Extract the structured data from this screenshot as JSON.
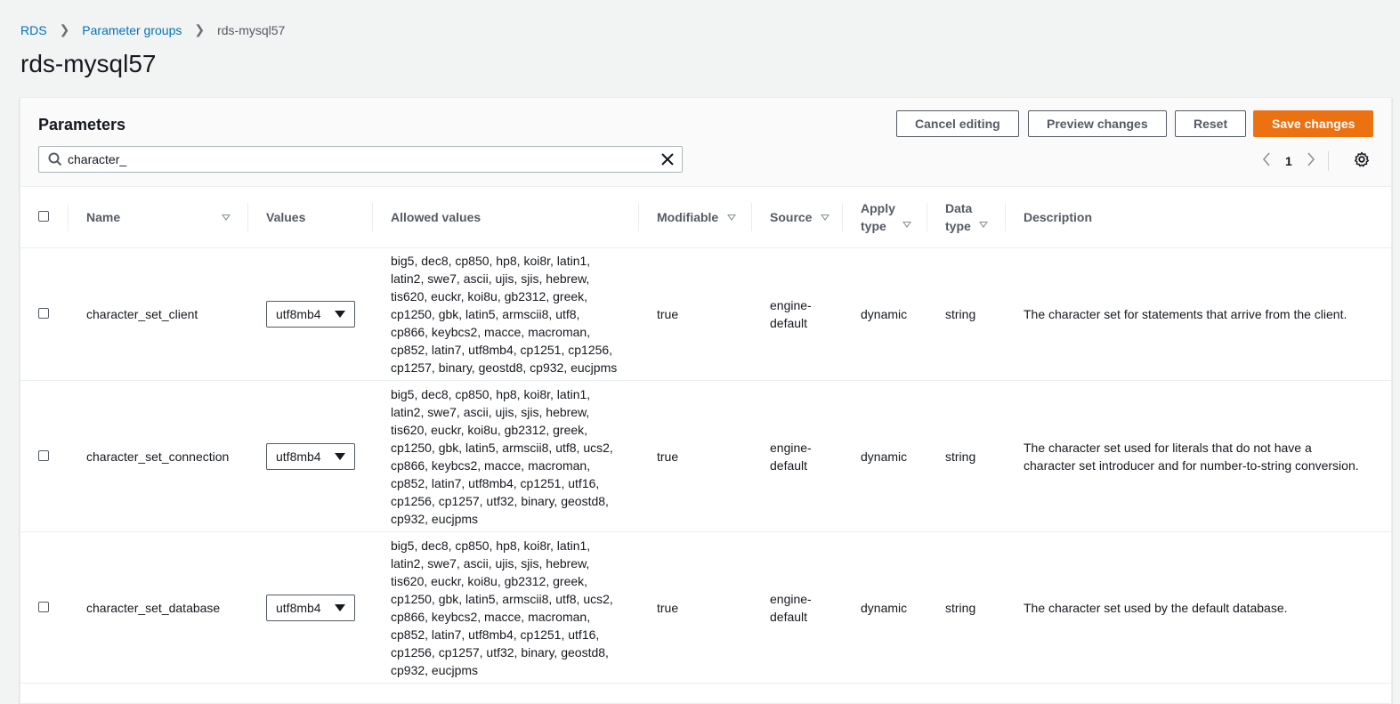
{
  "breadcrumb": {
    "root": "RDS",
    "parent": "Parameter groups",
    "current": "rds-mysql57"
  },
  "page_title": "rds-mysql57",
  "panel": {
    "title": "Parameters",
    "buttons": {
      "cancel": "Cancel editing",
      "preview": "Preview changes",
      "reset": "Reset",
      "save": "Save changes"
    },
    "search": {
      "value": "character_",
      "placeholder": ""
    },
    "pager": {
      "page": "1"
    }
  },
  "table": {
    "headers": {
      "name": "Name",
      "values": "Values",
      "allowed": "Allowed values",
      "modifiable": "Modifiable",
      "source": "Source",
      "apply_type": "Apply type",
      "data_type": "Data type",
      "description": "Description"
    },
    "rows": [
      {
        "name": "character_set_client",
        "value": "utf8mb4",
        "allowed": [
          "big5, dec8, cp850, hp8, koi8r, latin1,",
          "latin2, swe7, ascii, ujis, sjis, hebrew,",
          "tis620, euckr, koi8u, gb2312, greek,",
          "cp1250, gbk, latin5, armscii8, utf8,",
          "cp866, keybcs2, macce, macroman,",
          "cp852, latin7, utf8mb4, cp1251, cp1256,",
          "cp1257, binary, geostd8, cp932, eucjpms"
        ],
        "modifiable": "true",
        "source": [
          "engine-",
          "default"
        ],
        "apply_type": "dynamic",
        "data_type": "string",
        "description": [
          "The character set for statements that arrive from the client."
        ]
      },
      {
        "name": "character_set_connection",
        "value": "utf8mb4",
        "allowed": [
          "big5, dec8, cp850, hp8, koi8r, latin1,",
          "latin2, swe7, ascii, ujis, sjis, hebrew,",
          "tis620, euckr, koi8u, gb2312, greek,",
          "cp1250, gbk, latin5, armscii8, utf8, ucs2,",
          "cp866, keybcs2, macce, macroman,",
          "cp852, latin7, utf8mb4, cp1251, utf16,",
          "cp1256, cp1257, utf32, binary, geostd8,",
          "cp932, eucjpms"
        ],
        "modifiable": "true",
        "source": [
          "engine-",
          "default"
        ],
        "apply_type": "dynamic",
        "data_type": "string",
        "description": [
          "The character set used for literals that do not have a",
          "character set introducer and for number-to-string conversion."
        ]
      },
      {
        "name": "character_set_database",
        "value": "utf8mb4",
        "allowed": [
          "big5, dec8, cp850, hp8, koi8r, latin1,",
          "latin2, swe7, ascii, ujis, sjis, hebrew,",
          "tis620, euckr, koi8u, gb2312, greek,",
          "cp1250, gbk, latin5, armscii8, utf8, ucs2,",
          "cp866, keybcs2, macce, macroman,",
          "cp852, latin7, utf8mb4, cp1251, utf16,",
          "cp1256, cp1257, utf32, binary, geostd8,",
          "cp932, eucjpms"
        ],
        "modifiable": "true",
        "source": [
          "engine-",
          "default"
        ],
        "apply_type": "dynamic",
        "data_type": "string",
        "description": [
          "The character set used by the default database."
        ]
      }
    ]
  }
}
